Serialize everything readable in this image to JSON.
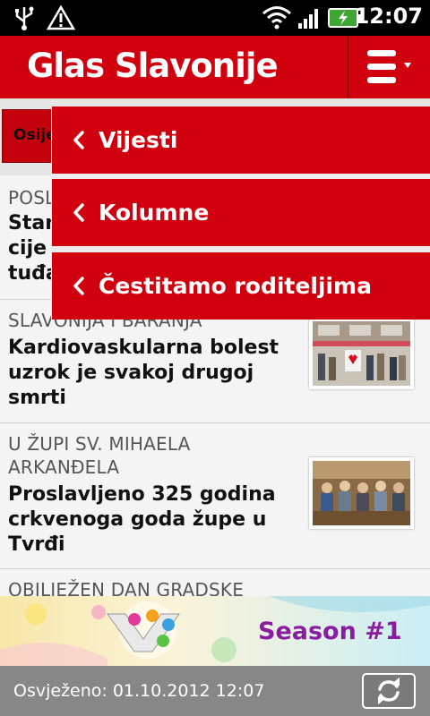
{
  "status_bar": {
    "time": "12:07"
  },
  "app_bar": {
    "title": "Glas Slavonije"
  },
  "tab_strip": {
    "active_tab": "Osijek"
  },
  "articles": [
    {
      "category": "POSL",
      "headline_lines": [
        "Stan",
        "cije",
        "tuđa"
      ]
    },
    {
      "category": "SLAVONIJA I BARANJA",
      "headline_lines": [
        "Kardiovaskularna bolest",
        "uzrok je svakoj drugoj",
        "smrti"
      ]
    },
    {
      "category_lines": [
        "U  ŽUPI SV. MIHAELA",
        "ARKANĐELA"
      ],
      "headline_lines": [
        "Proslavljeno 325 godina",
        "crkvenoga goda župe u",
        "Tvrđi"
      ]
    },
    {
      "category": "OBILJEŽEN DAN GRADSKE"
    }
  ],
  "menu": {
    "items": [
      "Vijesti",
      "Kolumne",
      "Čestitamo roditeljima"
    ]
  },
  "banner": {
    "text": "Season #1"
  },
  "bottom_bar": {
    "refreshed": "Osvježeno: 01.10.2012 12:07"
  },
  "colors": {
    "brand_red": "#d1000e",
    "bottom_bar": "#878787"
  }
}
